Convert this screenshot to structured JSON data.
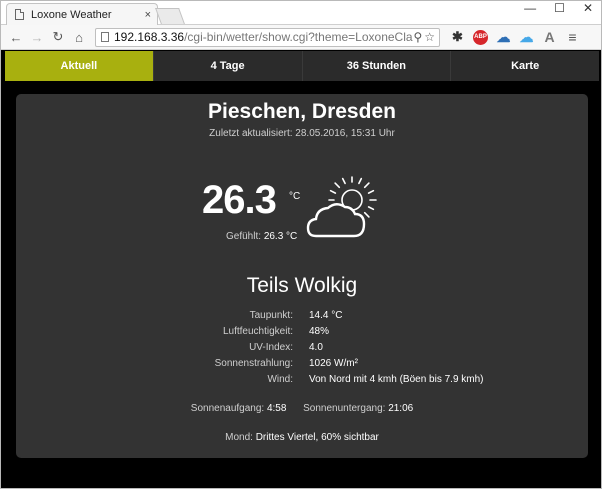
{
  "browser": {
    "tab_title": "Loxone Weather",
    "tab_close": "×",
    "win_min": "—",
    "win_max": "☐",
    "win_close": "✕",
    "url_host": "192.168.3.36",
    "url_path": "/cgi-bin/wetter/show.cgi?theme=LoxoneClas",
    "ext_abp": "ABP",
    "ext_a": "A"
  },
  "nav": {
    "tabs": [
      "Aktuell",
      "4 Tage",
      "36 Stunden",
      "Karte"
    ],
    "active_index": 0
  },
  "weather": {
    "location": "Pieschen, Dresden",
    "updated": "Zuletzt aktualisiert: 28.05.2016, 15:31 Uhr",
    "temperature": "26.3",
    "temp_unit": "°C",
    "feels_label": "Gefühlt:",
    "feels_value": "26.3 °C",
    "icon": "partly-cloudy-icon",
    "condition": "Teils Wolkig",
    "details": [
      {
        "label": "Taupunkt:",
        "value": "14.4 °C"
      },
      {
        "label": "Luftfeuchtigkeit:",
        "value": "48%"
      },
      {
        "label": "UV-Index:",
        "value": "4.0"
      },
      {
        "label": "Sonnenstrahlung:",
        "value": "1026 W/m²"
      },
      {
        "label": "Wind:",
        "value": "Von Nord mit 4 kmh (Böen bis 7.9 kmh)"
      }
    ],
    "sunrise_label": "Sonnenaufgang:",
    "sunrise_value": "4:58",
    "sunset_label": "Sonnenuntergang:",
    "sunset_value": "21:06",
    "moon_label": "Mond:",
    "moon_value": "Drittes Viertel, 60% sichtbar"
  },
  "colors": {
    "accent": "#a8b00f",
    "navbar": "#2b2b2b",
    "card": "#333333",
    "background": "#000000"
  }
}
